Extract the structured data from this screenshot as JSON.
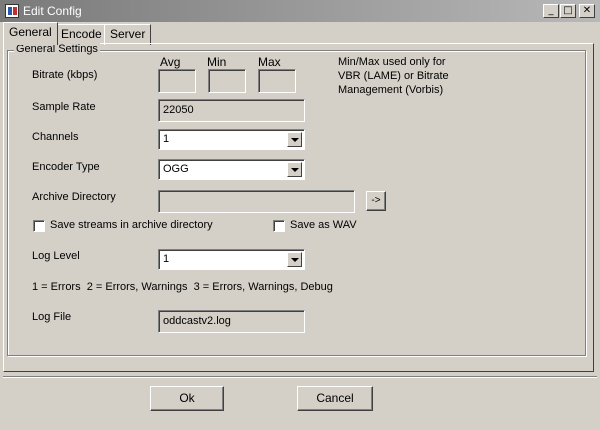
{
  "window": {
    "title": "Edit Config",
    "minimize": "_",
    "maximize": "□",
    "close": "✕"
  },
  "tabs": [
    {
      "label": "General"
    },
    {
      "label": "Encode"
    },
    {
      "label": "Server"
    }
  ],
  "group": {
    "label": "General Settings"
  },
  "bitrate": {
    "label": "Bitrate (kbps)",
    "avg_label": "Avg",
    "min_label": "Min",
    "max_label": "Max",
    "avg_value": "",
    "min_value": "",
    "max_value": "",
    "note": "Min/Max used only for VBR (LAME) or Bitrate Management (Vorbis)"
  },
  "sample_rate": {
    "label": "Sample Rate",
    "value": "22050"
  },
  "channels": {
    "label": "Channels",
    "value": "1"
  },
  "encoder_type": {
    "label": "Encoder Type",
    "value": "OGG"
  },
  "archive": {
    "label": "Archive Directory",
    "value": "",
    "browse_label": "->"
  },
  "save_streams": {
    "label": "Save streams in archive directory",
    "checked": false
  },
  "save_wav": {
    "label": "Save as WAV",
    "checked": false
  },
  "log_level": {
    "label": "Log Level",
    "value": "1",
    "help": "1 = Errors  2 = Errors, Warnings  3 = Errors, Warnings, Debug"
  },
  "log_file": {
    "label": "Log File",
    "value": "oddcastv2.log"
  },
  "buttons": {
    "ok": "Ok",
    "cancel": "Cancel"
  }
}
